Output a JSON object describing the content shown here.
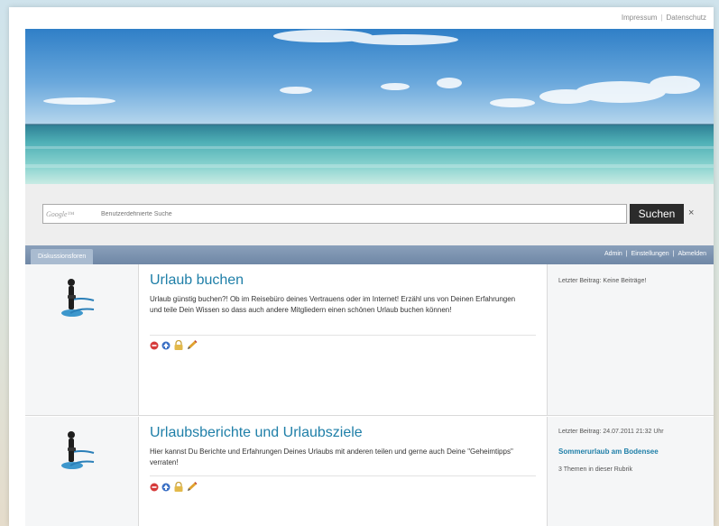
{
  "header": {
    "links": [
      "Impressum",
      "Datenschutz"
    ]
  },
  "search": {
    "google_label": "Google™",
    "placeholder": "Benutzerdefinierte Suche",
    "button_label": "Suchen",
    "clear_label": "×"
  },
  "nav": {
    "tab_label": "Diskussionsforen",
    "links": [
      "Admin",
      "Einstellungen",
      "Abmelden"
    ]
  },
  "forums": [
    {
      "title": "Urlaub buchen",
      "description": "Urlaub günstig buchen?! Ob im Reisebüro deines Vertrauens oder im Internet! Erzähl uns von Deinen Erfahrungen und teile Dein Wissen so dass auch andere Mitgliedern einen schönen Urlaub buchen können!",
      "last_post": "Letzter Beitrag: Keine Beiträge!",
      "last_topic": "",
      "topic_count": ""
    },
    {
      "title": "Urlaubsberichte und Urlaubsziele",
      "description": "Hier kannst Du Berichte und Erfahrungen Deines Urlaubs mit anderen teilen und gerne auch Deine \"Geheimtipps\" verraten!",
      "last_post": "Letzter Beitrag: 24.07.2011 21:32 Uhr",
      "last_topic": "Sommerurlaub am Bodensee",
      "topic_count": "3 Themen in dieser Rubrik"
    }
  ],
  "icons": {
    "delete": "delete-icon",
    "move_up": "move-up-icon",
    "lock": "lock-icon",
    "edit": "edit-icon",
    "forum_figure": "forum-figure-icon"
  },
  "colors": {
    "accent": "#1f7fa8",
    "nav": "#6f87a6",
    "button": "#2b2b2b"
  }
}
